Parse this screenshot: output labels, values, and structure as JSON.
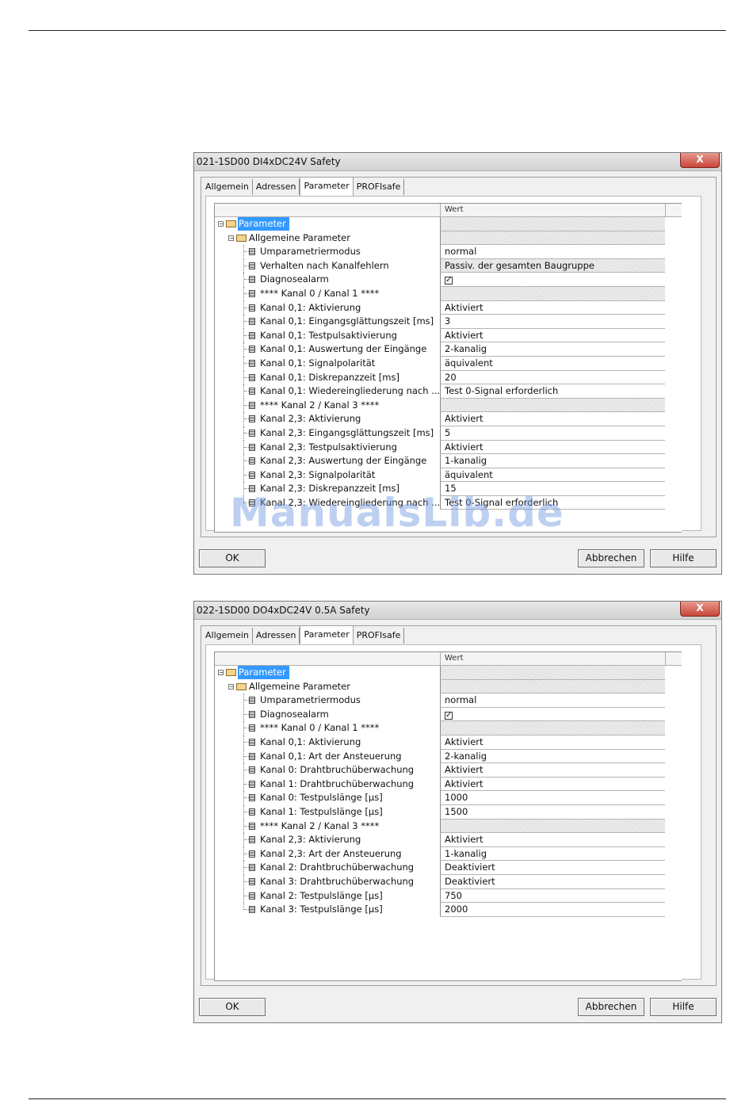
{
  "dialogs": [
    {
      "title": "021-1SD00 DI4xDC24V Safety",
      "close_glyph": "X",
      "tabs": [
        "Allgemein",
        "Adressen",
        "Parameter",
        "PROFIsafe"
      ],
      "active_tab": "Parameter",
      "value_column_header": "Wert",
      "rows": [
        {
          "name": "Parameter",
          "value": "",
          "level": 0,
          "type": "folder",
          "selected": true,
          "hatched": true
        },
        {
          "name": "Allgemeine Parameter",
          "value": "",
          "level": 1,
          "type": "folder",
          "hatched": true
        },
        {
          "name": "Umparametriermodus",
          "value": "normal",
          "level": 2,
          "type": "leaf"
        },
        {
          "name": "Verhalten nach Kanalfehlern",
          "value": "Passiv. der gesamten Baugruppe",
          "level": 2,
          "type": "leaf",
          "hatched": true
        },
        {
          "name": "Diagnosealarm",
          "value": "✓",
          "level": 2,
          "type": "leaf",
          "checkbox": true
        },
        {
          "name": "**** Kanal 0 / Kanal 1 ****",
          "value": "",
          "level": 2,
          "type": "leaf",
          "hatched": true
        },
        {
          "name": "Kanal 0,1: Aktivierung",
          "value": "Aktiviert",
          "level": 2,
          "type": "leaf"
        },
        {
          "name": "Kanal 0,1: Eingangsglättungszeit [ms]",
          "value": "3",
          "level": 2,
          "type": "leaf"
        },
        {
          "name": "Kanal 0,1: Testpulsaktivierung",
          "value": "Aktiviert",
          "level": 2,
          "type": "leaf"
        },
        {
          "name": "Kanal 0,1: Auswertung der Eingänge",
          "value": "2-kanalig",
          "level": 2,
          "type": "leaf"
        },
        {
          "name": "Kanal 0,1: Signalpolarität",
          "value": "äquivalent",
          "level": 2,
          "type": "leaf"
        },
        {
          "name": "Kanal 0,1: Diskrepanzzeit [ms]",
          "value": "20",
          "level": 2,
          "type": "leaf"
        },
        {
          "name": "Kanal 0,1: Wiedereingliederung nach ...",
          "value": "Test 0-Signal erforderlich",
          "level": 2,
          "type": "leaf"
        },
        {
          "name": "**** Kanal 2 / Kanal 3 ****",
          "value": "",
          "level": 2,
          "type": "leaf",
          "hatched": true
        },
        {
          "name": "Kanal 2,3: Aktivierung",
          "value": "Aktiviert",
          "level": 2,
          "type": "leaf"
        },
        {
          "name": "Kanal 2,3: Eingangsglättungszeit [ms]",
          "value": "5",
          "level": 2,
          "type": "leaf"
        },
        {
          "name": "Kanal 2,3: Testpulsaktivierung",
          "value": "Aktiviert",
          "level": 2,
          "type": "leaf"
        },
        {
          "name": "Kanal 2,3: Auswertung der Eingänge",
          "value": "1-kanalig",
          "level": 2,
          "type": "leaf"
        },
        {
          "name": "Kanal 2,3: Signalpolarität",
          "value": "äquivalent",
          "level": 2,
          "type": "leaf"
        },
        {
          "name": "Kanal 2,3: Diskrepanzzeit [ms]",
          "value": "15",
          "level": 2,
          "type": "leaf"
        },
        {
          "name": "Kanal 2,3: Wiedereingliederung nach ...",
          "value": "Test 0-Signal erforderlich",
          "level": 2,
          "type": "leaf"
        }
      ],
      "buttons": {
        "ok": "OK",
        "cancel": "Abbrechen",
        "help": "Hilfe"
      }
    },
    {
      "title": "022-1SD00 DO4xDC24V 0.5A Safety",
      "close_glyph": "X",
      "tabs": [
        "Allgemein",
        "Adressen",
        "Parameter",
        "PROFIsafe"
      ],
      "active_tab": "Parameter",
      "value_column_header": "Wert",
      "rows": [
        {
          "name": "Parameter",
          "value": "",
          "level": 0,
          "type": "folder",
          "selected": true,
          "hatched": true
        },
        {
          "name": "Allgemeine Parameter",
          "value": "",
          "level": 1,
          "type": "folder",
          "hatched": true
        },
        {
          "name": "Umparametriermodus",
          "value": "normal",
          "level": 2,
          "type": "leaf"
        },
        {
          "name": "Diagnosealarm",
          "value": "✓",
          "level": 2,
          "type": "leaf",
          "checkbox": true
        },
        {
          "name": "**** Kanal 0 / Kanal 1 ****",
          "value": "",
          "level": 2,
          "type": "leaf",
          "hatched": true
        },
        {
          "name": "Kanal 0,1: Aktivierung",
          "value": "Aktiviert",
          "level": 2,
          "type": "leaf"
        },
        {
          "name": "Kanal 0,1: Art der Ansteuerung",
          "value": "2-kanalig",
          "level": 2,
          "type": "leaf"
        },
        {
          "name": "Kanal 0: Drahtbruchüberwachung",
          "value": "Aktiviert",
          "level": 2,
          "type": "leaf"
        },
        {
          "name": "Kanal 1: Drahtbruchüberwachung",
          "value": "Aktiviert",
          "level": 2,
          "type": "leaf"
        },
        {
          "name": "Kanal 0: Testpulslänge [µs]",
          "value": "1000",
          "level": 2,
          "type": "leaf"
        },
        {
          "name": "Kanal 1: Testpulslänge [µs]",
          "value": "1500",
          "level": 2,
          "type": "leaf"
        },
        {
          "name": "**** Kanal 2 / Kanal 3 ****",
          "value": "",
          "level": 2,
          "type": "leaf",
          "hatched": true
        },
        {
          "name": "Kanal 2,3: Aktivierung",
          "value": "Aktiviert",
          "level": 2,
          "type": "leaf"
        },
        {
          "name": "Kanal 2,3: Art der Ansteuerung",
          "value": "1-kanalig",
          "level": 2,
          "type": "leaf"
        },
        {
          "name": "Kanal 2: Drahtbruchüberwachung",
          "value": "Deaktiviert",
          "level": 2,
          "type": "leaf"
        },
        {
          "name": "Kanal 3: Drahtbruchüberwachung",
          "value": "Deaktiviert",
          "level": 2,
          "type": "leaf"
        },
        {
          "name": "Kanal 2: Testpulslänge [µs]",
          "value": "750",
          "level": 2,
          "type": "leaf"
        },
        {
          "name": "Kanal 3: Testpulslänge [µs]",
          "value": "2000",
          "level": 2,
          "type": "leaf"
        }
      ],
      "buttons": {
        "ok": "OK",
        "cancel": "Abbrechen",
        "help": "Hilfe"
      }
    }
  ],
  "watermark": "ManualsLib.de",
  "colors": {
    "selection": "#3399ff",
    "close_button": "#c9453a",
    "dialog_bg": "#f0f0f0"
  }
}
